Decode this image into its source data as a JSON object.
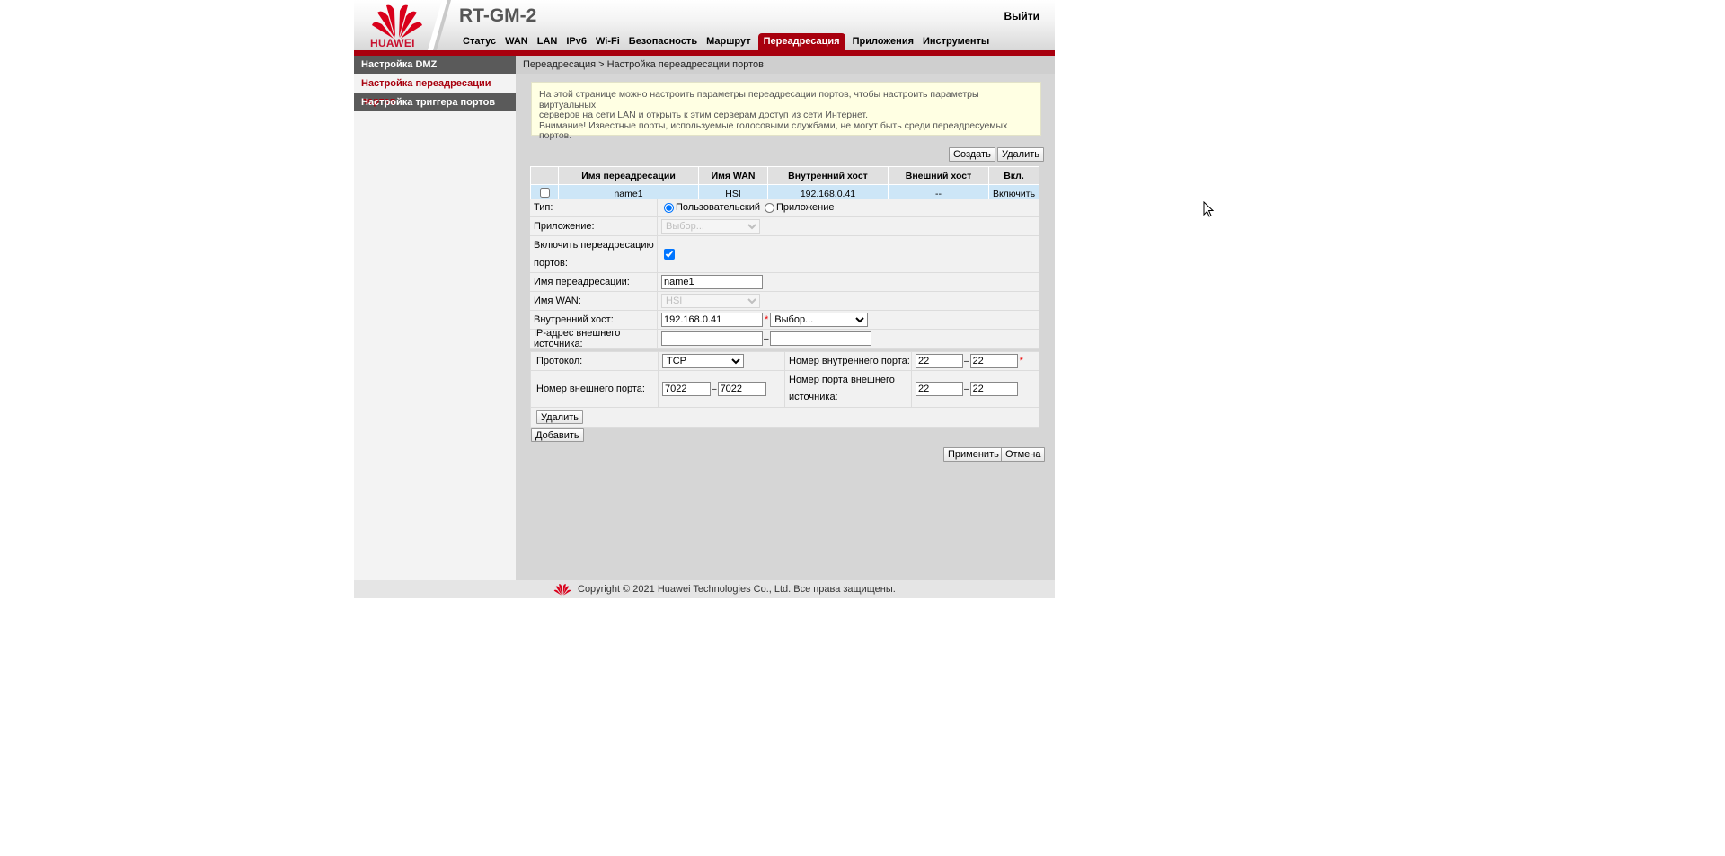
{
  "header": {
    "brand": "HUAWEI",
    "model": "RT-GM-2",
    "logout": "Выйти"
  },
  "nav": [
    "Статус",
    "WAN",
    "LAN",
    "IPv6",
    "Wi-Fi",
    "Безопасность",
    "Маршрут",
    "Переадресация",
    "Приложения",
    "Инструменты"
  ],
  "nav_active": "Переадресация",
  "sidebar": {
    "items": [
      {
        "label": "Настройка DMZ"
      },
      {
        "label": "Настройка переадресации портов"
      },
      {
        "label": "Настройка триггера портов"
      }
    ]
  },
  "main": {
    "breadcrumb": "Переадресация > Настройка переадресации портов",
    "notice": {
      "line1": "На этой странице можно настроить параметры переадресации портов, чтобы настроить параметры виртуальных",
      "line2": "серверов на сети LAN и открыть к этим серверам доступ из сети Интернет.",
      "line3": "Внимание! Известные порты, используемые голосовыми службами, не могут быть среди переадресуемых портов."
    },
    "create_button": "Создать",
    "delete_button": "Удалить",
    "table": {
      "headers": [
        "Имя переадресации",
        "Имя WAN",
        "Внутренний хост",
        "Внешний хост",
        "Вкл."
      ],
      "rows": [
        {
          "name": "name1",
          "wan": "HSI",
          "internal_host": "192.168.0.41",
          "external_host": "--",
          "enabled": "Включить"
        }
      ]
    },
    "form": {
      "type_label": "Тип:",
      "type_user": "Пользовательский",
      "type_app": "Приложение",
      "app_label": "Приложение:",
      "app_placeholder": "Выбор...",
      "enable_label_1": "Включить переадресацию",
      "enable_label_2": "портов:",
      "name_label": "Имя переадресации:",
      "name_value": "name1",
      "wan_label": "Имя WAN:",
      "wan_value": "HSI",
      "host_label": "Внутренний хост:",
      "host_value": "192.168.0.41",
      "host_select": "Выбор...",
      "src_ip_label": "IP-адрес внешнего источника:"
    },
    "ports": {
      "protocol_label": "Протокол:",
      "protocol_value": "TCP",
      "int_port_label": "Номер внутреннего порта:",
      "int_port_from": "22",
      "int_port_to": "22",
      "ext_port_label": "Номер внешнего порта:",
      "ext_port_from": "7022",
      "ext_port_to": "7022",
      "ext_src_port_label_1": "Номер порта внешнего",
      "ext_src_port_label_2": "источника:",
      "ext_src_port_from": "22",
      "ext_src_port_to": "22",
      "delete_button": "Удалить"
    },
    "add_button": "Добавить",
    "apply_button": "Применить",
    "cancel_button": "Отмена"
  },
  "footer": "Copyright © 2021 Huawei Technologies Co., Ltd. Все права защищены.",
  "colors": {
    "accent": "#a8000e",
    "highlight_row": "#cde6f7",
    "notice_bg": "#ffffe3"
  }
}
